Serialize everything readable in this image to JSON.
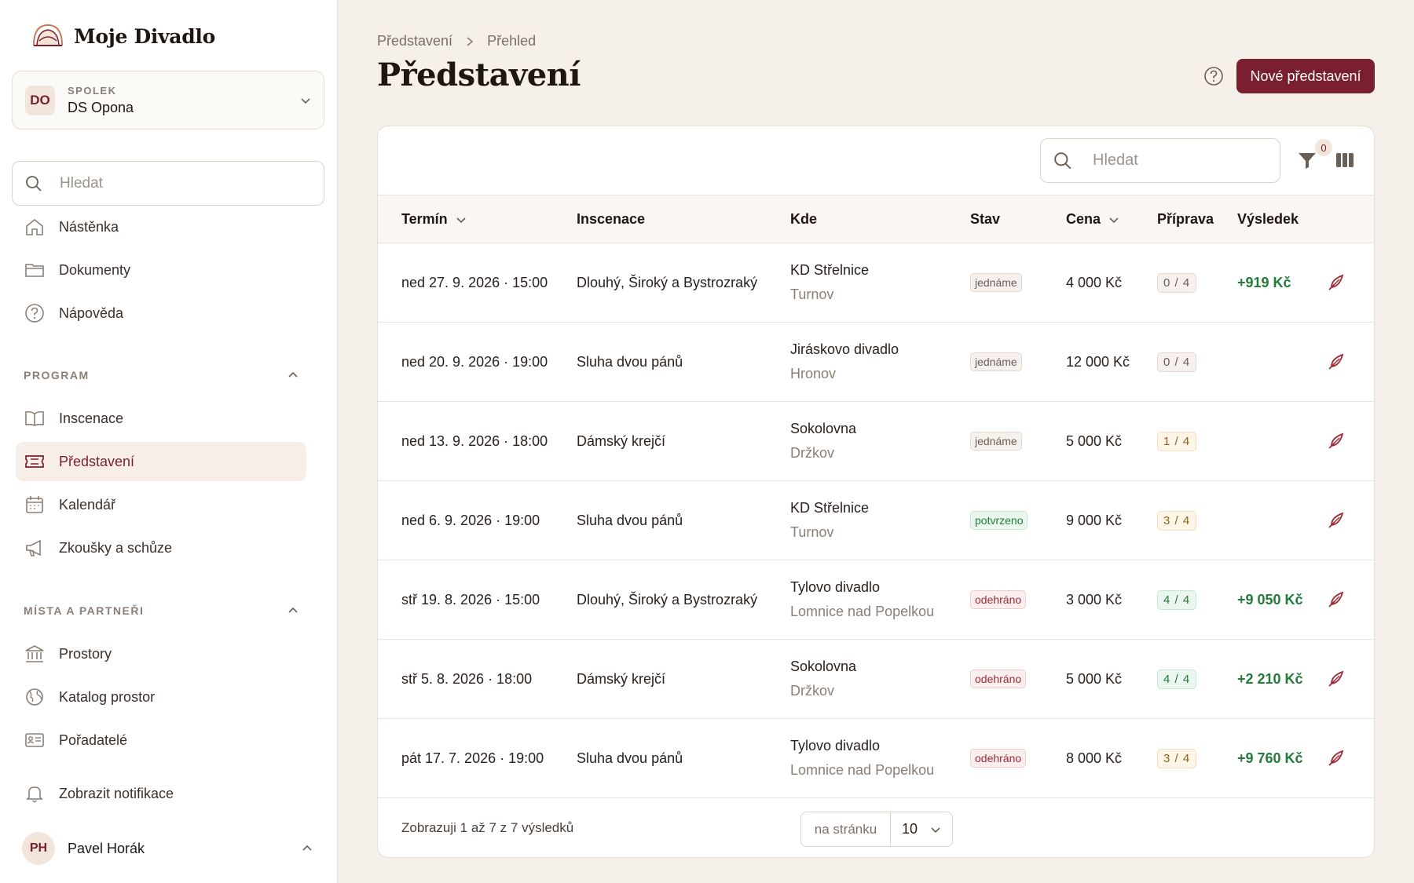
{
  "brand": {
    "name": "Moje Divadlo"
  },
  "org": {
    "initials": "DO",
    "kind": "SPOLEK",
    "name": "DS Opona"
  },
  "sidebar": {
    "search_placeholder": "Hledat",
    "top_items": [
      {
        "label": "Nástěnka",
        "icon": "home-icon"
      },
      {
        "label": "Dokumenty",
        "icon": "folder-icon"
      },
      {
        "label": "Nápověda",
        "icon": "help-icon"
      }
    ],
    "sections": [
      {
        "title": "PROGRAM",
        "items": [
          {
            "label": "Inscenace",
            "icon": "book-icon"
          },
          {
            "label": "Představení",
            "icon": "ticket-icon",
            "active": true
          },
          {
            "label": "Kalendář",
            "icon": "calendar-icon"
          },
          {
            "label": "Zkoušky a schůze",
            "icon": "megaphone-icon"
          }
        ]
      },
      {
        "title": "MÍSTA A PARTNEŘI",
        "items": [
          {
            "label": "Prostory",
            "icon": "building-icon"
          },
          {
            "label": "Katalog prostor",
            "icon": "globe-icon"
          },
          {
            "label": "Pořadatelé",
            "icon": "id-card-icon"
          }
        ]
      }
    ],
    "notifications": "Zobrazit notifikace",
    "user": {
      "initials": "PH",
      "name": "Pavel Horák"
    }
  },
  "breadcrumb": [
    "Představení",
    "Přehled"
  ],
  "page_title": "Představení",
  "new_button": "Nové představení",
  "table": {
    "search_placeholder": "Hledat",
    "filter_count": "0",
    "columns": [
      "Termín",
      "Inscenace",
      "Kde",
      "Stav",
      "Cena",
      "Příprava",
      "Výsledek"
    ],
    "rows": [
      {
        "date": "ned 27. 9. 2026 · 15:00",
        "show": "Dlouhý, Široký a Bystrozraký",
        "venue": "KD Střelnice",
        "city": "Turnov",
        "status": "jednáme",
        "price": "4 000 Kč",
        "prep": "0 / 4",
        "result": "+919 Kč"
      },
      {
        "date": "ned 20. 9. 2026 · 19:00",
        "show": "Sluha dvou pánů",
        "venue": "Jiráskovo divadlo",
        "city": "Hronov",
        "status": "jednáme",
        "price": "12 000 Kč",
        "prep": "0 / 4",
        "result": ""
      },
      {
        "date": "ned 13. 9. 2026 · 18:00",
        "show": "Dámský krejčí",
        "venue": "Sokolovna",
        "city": "Držkov",
        "status": "jednáme",
        "price": "5 000 Kč",
        "prep": "1 / 4",
        "result": ""
      },
      {
        "date": "ned 6. 9. 2026 · 19:00",
        "show": "Sluha dvou pánů",
        "venue": "KD Střelnice",
        "city": "Turnov",
        "status": "potvrzeno",
        "price": "9 000 Kč",
        "prep": "3 / 4",
        "result": ""
      },
      {
        "date": "stř 19. 8. 2026 · 15:00",
        "show": "Dlouhý, Široký a Bystrozraký",
        "venue": "Tylovo divadlo",
        "city": "Lomnice nad Popelkou",
        "status": "odehráno",
        "price": "3 000 Kč",
        "prep": "4 / 4",
        "result": "+9 050 Kč"
      },
      {
        "date": "stř 5. 8. 2026 · 18:00",
        "show": "Dámský krejčí",
        "venue": "Sokolovna",
        "city": "Držkov",
        "status": "odehráno",
        "price": "5 000 Kč",
        "prep": "4 / 4",
        "result": "+2 210 Kč"
      },
      {
        "date": "pát 17. 7. 2026 · 19:00",
        "show": "Sluha dvou pánů",
        "venue": "Tylovo divadlo",
        "city": "Lomnice nad Popelkou",
        "status": "odehráno",
        "price": "8 000 Kč",
        "prep": "3 / 4",
        "result": "+9 760 Kč"
      }
    ],
    "footer_text": "Zobrazuji 1 až 7 z 7 výsledků",
    "per_page_label": "na stránku",
    "per_page_value": "10"
  },
  "colors": {
    "accent": "#7a1f30",
    "positive": "#237a3b",
    "background": "#f5f0ea"
  }
}
